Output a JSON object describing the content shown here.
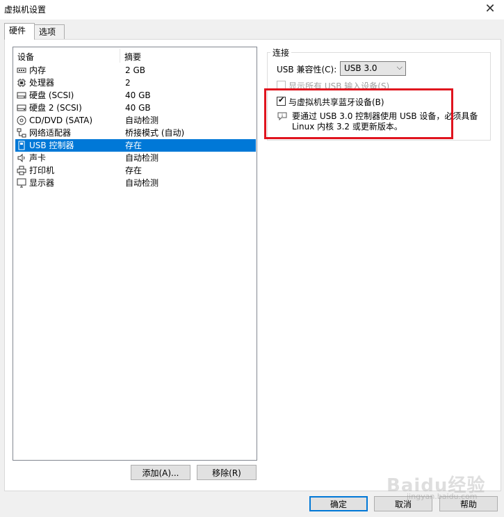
{
  "window": {
    "title": "虚拟机设置"
  },
  "tabs": [
    {
      "label": "硬件"
    },
    {
      "label": "选项"
    }
  ],
  "device_list": {
    "columns": {
      "device": "设备",
      "summary": "摘要"
    },
    "rows": [
      {
        "name": "内存",
        "summary": "2 GB",
        "icon": "memory-icon"
      },
      {
        "name": "处理器",
        "summary": "2",
        "icon": "processor-icon"
      },
      {
        "name": "硬盘 (SCSI)",
        "summary": "40 GB",
        "icon": "hard-disk-icon"
      },
      {
        "name": "硬盘 2 (SCSI)",
        "summary": "40 GB",
        "icon": "hard-disk-icon"
      },
      {
        "name": "CD/DVD (SATA)",
        "summary": "自动检测",
        "icon": "cd-dvd-icon"
      },
      {
        "name": "网络适配器",
        "summary": "桥接模式 (自动)",
        "icon": "network-adapter-icon"
      },
      {
        "name": "USB 控制器",
        "summary": "存在",
        "icon": "usb-icon",
        "selected": true
      },
      {
        "name": "声卡",
        "summary": "自动检测",
        "icon": "sound-card-icon"
      },
      {
        "name": "打印机",
        "summary": "存在",
        "icon": "printer-icon"
      },
      {
        "name": "显示器",
        "summary": "自动检测",
        "icon": "display-icon"
      }
    ]
  },
  "buttons": {
    "add": "添加(A)...",
    "remove": "移除(R)",
    "ok": "确定",
    "cancel": "取消",
    "help": "帮助"
  },
  "connection": {
    "legend": "连接",
    "compat_label": "USB 兼容性(C):",
    "compat_value": "USB 3.0",
    "show_all_input": {
      "label": "显示所有 USB 输入设备(S)",
      "checked": false,
      "disabled": true
    },
    "share_bluetooth": {
      "label": "与虚拟机共享蓝牙设备(B)",
      "checked": true
    },
    "info_line1": "要通过 USB 3.0 控制器使用 USB 设备，必须具备",
    "info_line2": "Linux 内核 3.2 或更新版本。"
  },
  "watermark": {
    "text": "Baidu经验",
    "url": "jingyan.baidu.com"
  },
  "colors": {
    "selection": "#0078d7",
    "highlight_box": "#e0141e"
  }
}
